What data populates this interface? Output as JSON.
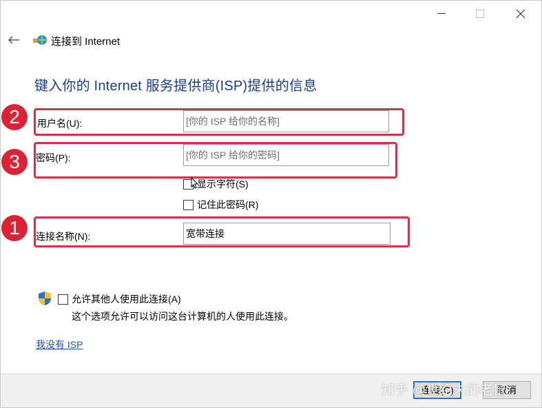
{
  "window": {
    "title": "连接到 Internet",
    "buttons": {
      "minimize": "minimize-icon",
      "maximize": "maximize-icon",
      "close": "close-icon"
    }
  },
  "header": {
    "back_icon": "back-arrow-icon",
    "app_icon": "network-globe-icon",
    "title": "连接到 Internet"
  },
  "heading": "键入你的 Internet 服务提供商(ISP)提供的信息",
  "form": {
    "username": {
      "label": "用户名(U):",
      "placeholder": "[你的 ISP 给你的名称]",
      "value": ""
    },
    "password": {
      "label": "密码(P):",
      "placeholder": "[你的 ISP 给你的密码]",
      "value": ""
    },
    "show_chars": {
      "label": "显示字符(S)",
      "checked": false
    },
    "remember_password": {
      "label": "记住此密码(R)",
      "checked": false
    },
    "connection_name": {
      "label": "连接名称(N):",
      "value": "宽带连接"
    }
  },
  "annotations": {
    "badge_1": "1",
    "badge_2": "2",
    "badge_3": "3",
    "highlight_color": "#d93048"
  },
  "allow_others": {
    "icon": "uac-shield-icon",
    "label": "允许其他人使用此连接(A)",
    "checked": false,
    "description": "这个选项允许可以访问这台计算机的人使用此连接。"
  },
  "no_isp_link": "我没有 ISP",
  "footer": {
    "connect_label": "连接(C)",
    "cancel_label": "取消"
  },
  "watermark": "知乎 @世纪末的老鼠",
  "colors": {
    "heading": "#1a3d8f",
    "link": "#1a55b0",
    "badge": "#dc2235",
    "primary_border": "#1e73d8"
  }
}
